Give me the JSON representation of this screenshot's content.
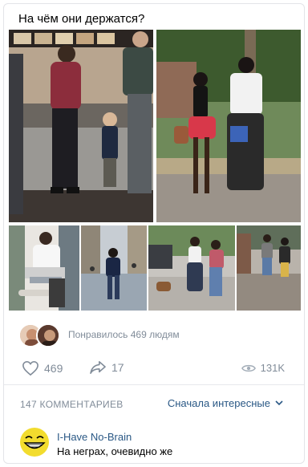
{
  "post": {
    "text": "На чём они держатся?",
    "photos": [
      {
        "label": "photo-mcdonalds-counter"
      },
      {
        "label": "photo-couple-street"
      },
      {
        "label": "photo-man-laptop"
      },
      {
        "label": "photo-man-walking-street"
      },
      {
        "label": "photo-man-walking-dog"
      },
      {
        "label": "photo-people-walking"
      }
    ]
  },
  "likes": {
    "summary": "Понравилось 469 людям",
    "count": "469"
  },
  "shares": {
    "count": "17"
  },
  "views": {
    "count": "131K"
  },
  "comments": {
    "header": "147 КОММЕНТАРИЕВ",
    "sort_label": "Сначала интересные",
    "items": [
      {
        "author": "I-Have No-Brain",
        "text": "На неграх, очевидно же"
      }
    ]
  },
  "colors": {
    "link": "#2a5885",
    "secondary": "#818c99"
  }
}
